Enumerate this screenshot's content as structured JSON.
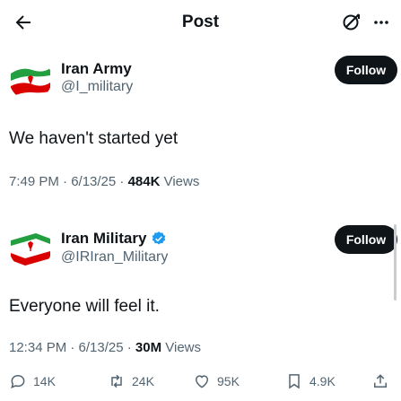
{
  "header": {
    "title": "Post"
  },
  "posts": [
    {
      "name": "Iran Army",
      "handle": "@I_military",
      "follow": "Follow",
      "text": "We haven't started yet",
      "time": "7:49 PM · 6/13/25 · ",
      "views": "484K",
      "views_label": " Views"
    },
    {
      "name": "Iran Military",
      "handle": "@IRIran_Military",
      "follow": "Follow",
      "text": "Everyone will feel it.",
      "time": "12:34 PM · 6/13/25 · ",
      "views": "30M",
      "views_label": " Views"
    }
  ],
  "actions": {
    "replies": "14K",
    "reposts": "24K",
    "likes": "95K",
    "bookmarks": "4.9K"
  },
  "colors": {
    "text": "#0f1419",
    "muted": "#536471",
    "verified": "#1d9bf0",
    "flag_green": "#239f40",
    "flag_red": "#da0000"
  },
  "icons": [
    "back-arrow-icon",
    "grok-icon",
    "more-icon",
    "verified-badge-icon",
    "reply-icon",
    "repost-icon",
    "like-icon",
    "bookmark-icon",
    "share-icon"
  ]
}
